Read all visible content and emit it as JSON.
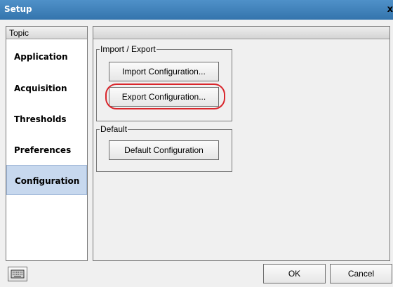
{
  "window": {
    "title": "Setup",
    "close_label": "x"
  },
  "sidebar": {
    "header": "Topic",
    "items": [
      {
        "label": "Application"
      },
      {
        "label": "Acquisition"
      },
      {
        "label": "Thresholds"
      },
      {
        "label": "Preferences"
      },
      {
        "label": "Configuration",
        "selected": true
      }
    ]
  },
  "main": {
    "import_export": {
      "legend": "Import / Export",
      "import_label": "Import Configuration...",
      "export_label": "Export Configuration..."
    },
    "default": {
      "legend": "Default",
      "default_label": "Default Configuration"
    }
  },
  "footer": {
    "keyboard_icon": "keyboard-icon",
    "ok_label": "OK",
    "cancel_label": "Cancel"
  },
  "colors": {
    "title_bar": "#3f83bf",
    "selected_item": "#c7d8ee",
    "highlight": "#d9262c"
  }
}
